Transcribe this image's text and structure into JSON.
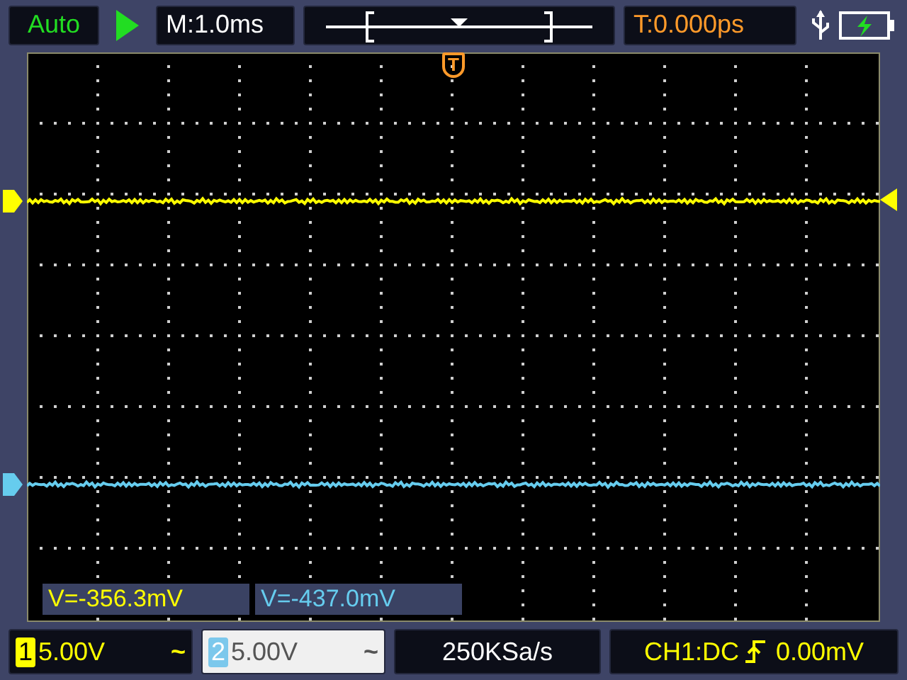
{
  "top_bar": {
    "mode": "Auto",
    "running": true,
    "timebase": "M:1.0ms",
    "trigger_time": "T:0.000ps",
    "usb_connected": true,
    "battery_charging": true
  },
  "trigger_marker": "T",
  "measurements": [
    {
      "text": "V=-356.3mV"
    },
    {
      "text": "V=-437.0mV"
    }
  ],
  "channels": [
    {
      "number": "1",
      "scale": "5.00V",
      "coupling": "~",
      "selected": false,
      "color": "#ffff00"
    },
    {
      "number": "2",
      "scale": "5.00V",
      "coupling": "~",
      "selected": true,
      "color": "#66ccee"
    }
  ],
  "sample_rate": "250KSa/s",
  "trigger_info": {
    "source": "CH1:DC",
    "rising_edge": true,
    "level": "0.00mV"
  }
}
